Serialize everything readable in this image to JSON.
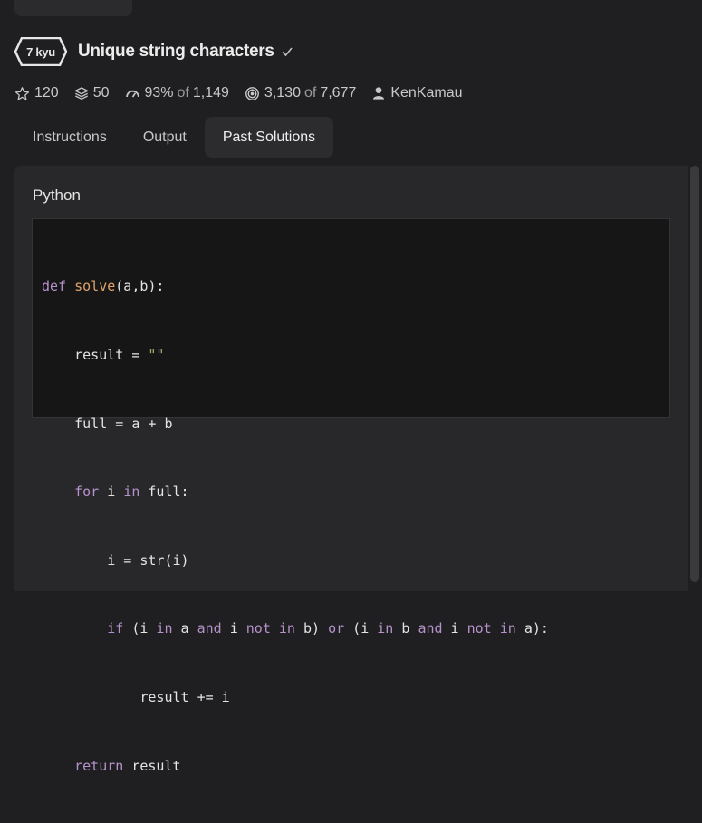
{
  "kata": {
    "rank": "7 kyu",
    "title": "Unique string characters",
    "check_icon": "check-icon"
  },
  "stats": {
    "stars": "120",
    "collections": "50",
    "satisfaction_percent": "93%",
    "satisfaction_of": "of",
    "satisfaction_votes": "1,149",
    "completed": "3,130",
    "completed_of": "of",
    "attempted": "7,677",
    "author": "KenKamau"
  },
  "tabs": [
    {
      "label": "Instructions",
      "active": false
    },
    {
      "label": "Output",
      "active": false
    },
    {
      "label": "Past Solutions",
      "active": true
    }
  ],
  "solution": {
    "language": "Python",
    "code_lines": [
      "def solve(a,b):",
      "    result = \"\"",
      "    full = a + b",
      "    for i in full:",
      "        i = str(i)",
      "        if (i in a and i not in b) or (i in b and i not in a):",
      "            result += i",
      "    return result"
    ]
  },
  "colors": {
    "background": "#1f1f21",
    "panel": "#28282a",
    "code_background": "#161617",
    "keyword": "#b592c9",
    "function": "#e0a46b",
    "string": "#9fb06d"
  }
}
